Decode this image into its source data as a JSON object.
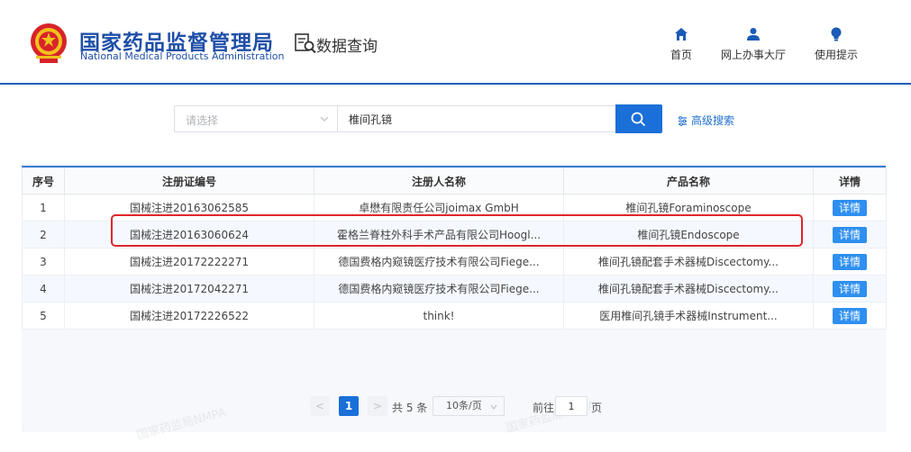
{
  "header": {
    "logo_cn": "国家药品监督管理局",
    "logo_en": "National Medical Products Administration",
    "section_title": "数据查询",
    "nav": [
      {
        "label": "首页",
        "icon": "home-icon"
      },
      {
        "label": "网上办事大厅",
        "icon": "user-icon"
      },
      {
        "label": "使用提示",
        "icon": "lightbulb-icon"
      }
    ]
  },
  "search": {
    "select_placeholder": "请选择",
    "query": "椎间孔镜",
    "advanced_label": "高级搜索"
  },
  "table": {
    "columns": [
      "序号",
      "注册证编号",
      "注册人名称",
      "产品名称",
      "详情"
    ],
    "detail_label": "详情",
    "rows": [
      {
        "index": "1",
        "reg_no": "国械注进20163062585",
        "registrant": "卓懋有限责任公司joimax GmbH",
        "product": "椎间孔镜Foraminoscope"
      },
      {
        "index": "2",
        "reg_no": "国械注进20163060624",
        "registrant": "霍格兰脊柱外科手术产品有限公司Hoogl...",
        "product": "椎间孔镜Endoscope"
      },
      {
        "index": "3",
        "reg_no": "国械注进20172222271",
        "registrant": "德国费格内窥镜医疗技术有限公司Fiege...",
        "product": "椎间孔镜配套手术器械Discectomy..."
      },
      {
        "index": "4",
        "reg_no": "国械注进20172042271",
        "registrant": "德国费格内窥镜医疗技术有限公司Fiege...",
        "product": "椎间孔镜配套手术器械Discectomy..."
      },
      {
        "index": "5",
        "reg_no": "国械注进20172226522",
        "registrant": "think!",
        "product": "医用椎间孔镜手术器械Instrument..."
      }
    ]
  },
  "pagination": {
    "prev": "<",
    "current_page": "1",
    "next": ">",
    "total_text": "共 5 条",
    "page_size": "10条/页",
    "goto_label": "前往",
    "goto_value": "1",
    "page_suffix": "页"
  },
  "watermark": "国家药监局NMPA",
  "colors": {
    "brand_blue": "#1f4fa8",
    "accent": "#1a6fd8",
    "detail_button": "#2e8ff0",
    "highlight_box": "#e0262b"
  }
}
